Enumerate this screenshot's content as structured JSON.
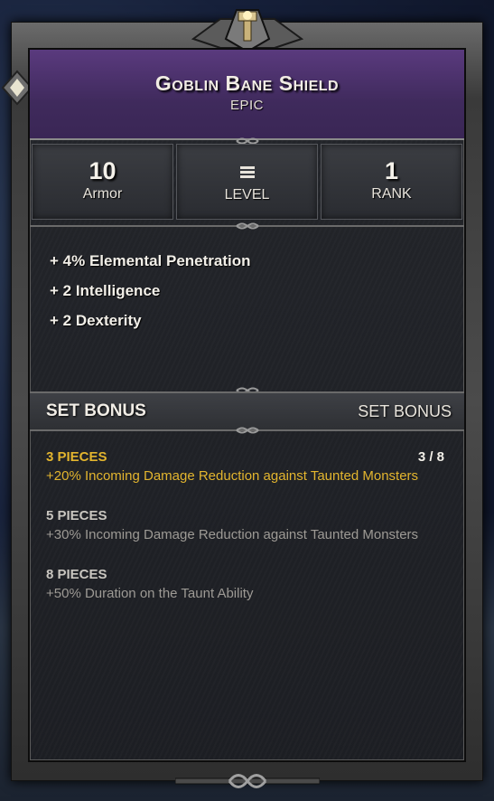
{
  "item": {
    "name": "Goblin Bane Shield",
    "rarity": "EPIC"
  },
  "stats": [
    {
      "value": "10",
      "label": "Armor"
    },
    {
      "value": "",
      "label": "LEVEL",
      "icon": "level-bars-icon"
    },
    {
      "value": "1",
      "label": "RANK"
    }
  ],
  "attributes": [
    "+ 4% Elemental Penetration",
    "+ 2  Intelligence",
    "+ 2  Dexterity"
  ],
  "set_bonus": {
    "title": "SET BONUS",
    "name": "SET BONUS",
    "progress": "3 / 8",
    "tiers": [
      {
        "pieces": "3 PIECES",
        "description": "+20% Incoming Damage Reduction against Taunted Monsters",
        "active": true
      },
      {
        "pieces": "5 PIECES",
        "description": "+30% Incoming Damage Reduction against Taunted Monsters",
        "active": false
      },
      {
        "pieces": "8 PIECES",
        "description": "+50% Duration on the Taunt Ability",
        "active": false
      }
    ]
  },
  "colors": {
    "header": "#4a2f6a",
    "active_bonus": "#e3b52e",
    "inactive_bonus": "#9d9a95"
  }
}
